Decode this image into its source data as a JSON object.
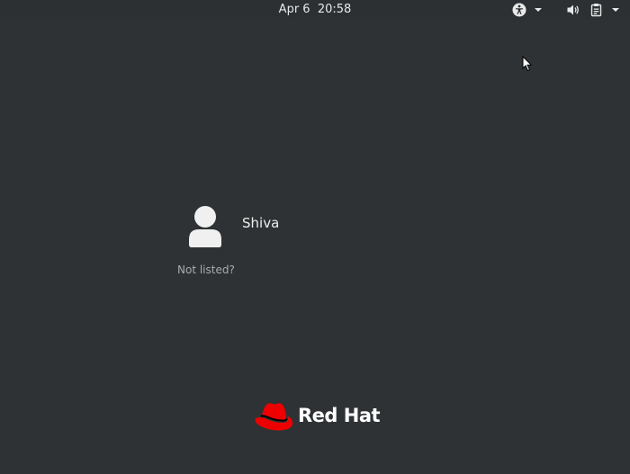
{
  "topbar": {
    "date": "Apr 6",
    "time": "20:58",
    "icons": [
      "accessibility-icon",
      "dropdown-arrow-icon",
      "volume-icon",
      "clipboard-icon",
      "dropdown-arrow-icon"
    ]
  },
  "login": {
    "users": [
      {
        "name": "Shiva",
        "avatar_icon": "user-avatar-icon"
      }
    ],
    "not_listed_label": "Not listed?"
  },
  "branding": {
    "logo_text": "Red Hat",
    "logo_color": "#ee0000"
  },
  "colors": {
    "background": "#2e3234",
    "text": "#eeeeec",
    "muted_text": "#a9acad"
  }
}
